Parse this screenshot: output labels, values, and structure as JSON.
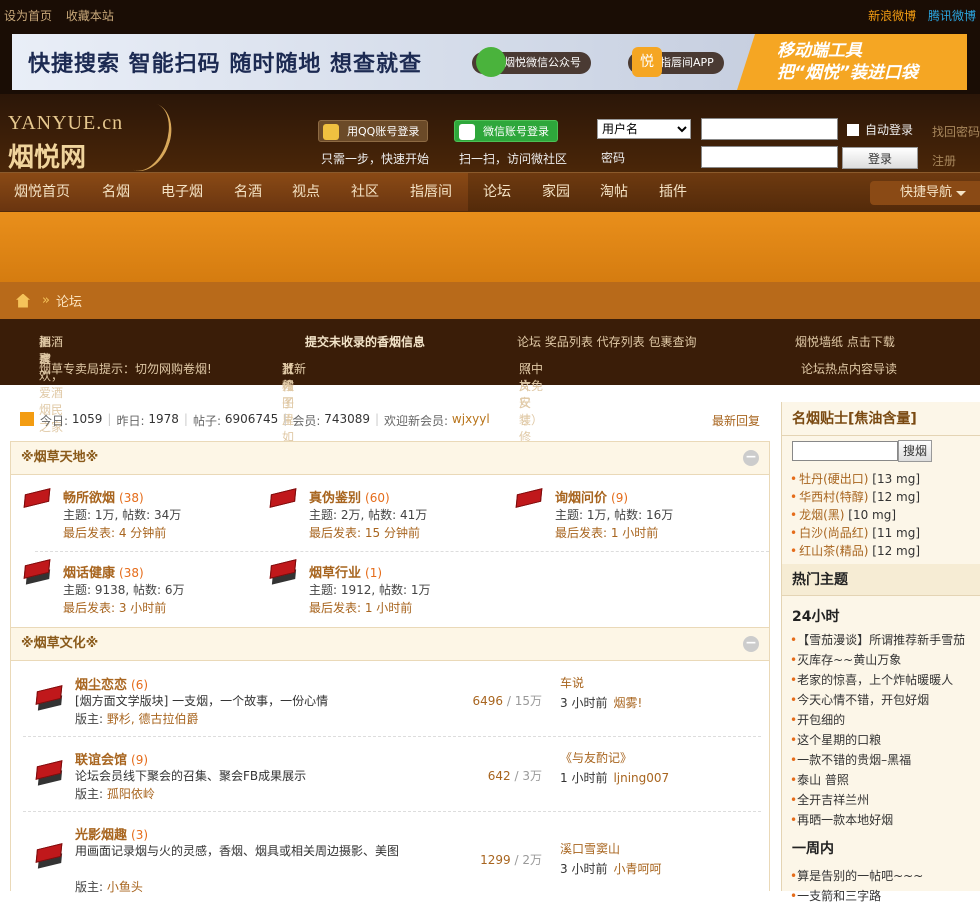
{
  "top": {
    "set_home": "设为首页",
    "bookmark": "收藏本站",
    "sina": "新浪微博",
    "tencent": "腾讯微博"
  },
  "banner": {
    "slogan": "快捷搜索  智能扫码  随时随地  想查就查",
    "wechat": "烟悦微信公众号",
    "app": "指唇间APP",
    "right1": "移动端工具",
    "right2": "把“烟悦”装进口袋",
    "app_icon": "悦"
  },
  "header": {
    "logo_en": "YANYUE.cn",
    "logo_cn": "烟悦网",
    "qq_login": "用QQ账号登录",
    "qq_sub": "只需一步，快速开始",
    "wx_login": "微信账号登录",
    "wx_sub": "扫一扫，访问微社区",
    "username_select": "用户名",
    "password_label": "密码",
    "auto_login": "自动登录",
    "login": "登录",
    "find_pwd": "找回密码",
    "register": "注册"
  },
  "nav": {
    "items": [
      "烟悦首页",
      "名烟",
      "电子烟",
      "名酒",
      "视点",
      "社区",
      "指唇间",
      "论坛",
      "家园",
      "淘帖",
      "插件"
    ],
    "quick": "快捷导航"
  },
  "crumb": {
    "current": "论坛"
  },
  "notice": {
    "n1a": "相聚",
    "n1b": "酒肆",
    "n1c": "把酒言欢，爱酒烟民之家",
    "n2": "提交未收录的香烟信息",
    "n3": "论坛  奖品列表  代存列表  包裹查询",
    "n4": "烟悦墙纸    点击下载",
    "n5": "烟草专卖局提示：切勿网购卷烟!",
    "n6a": "【新人",
    "n6b": "教程",
    "n6c": "】帖子里如何",
    "n6d": "上传图片",
    "n7a": "照片尺寸修改软件",
    "n7b": "（中文免安装）",
    "n8": "论坛热点内容导读"
  },
  "stats": {
    "today_l": "今日:",
    "today": "1059",
    "yest_l": "昨日:",
    "yest": "1978",
    "posts_l": "帖子:",
    "posts": "6906745",
    "members_l": "会员:",
    "members": "743089",
    "welcome": "欢迎新会员:",
    "new_member": "wjxyyl",
    "latest": "最新回复"
  },
  "cat1": {
    "title": "※烟草天地※",
    "collapse": "−"
  },
  "forums1": [
    {
      "name": "畅所欲烟",
      "count": "(38)",
      "stats": "主题: 1万, 帖数: 34万",
      "last": "最后发表: 4 分钟前"
    },
    {
      "name": "真伪鉴别",
      "count": "(60)",
      "stats": "主题: 2万, 帖数: 41万",
      "last": "最后发表: 15 分钟前"
    },
    {
      "name": "询烟问价",
      "count": "(9)",
      "stats": "主题: 1万, 帖数: 16万",
      "last": "最后发表: 1 小时前"
    },
    {
      "name": "烟话健康",
      "count": "(38)",
      "stats": "主题: 9138, 帖数: 6万",
      "last": "最后发表: 3 小时前"
    },
    {
      "name": "烟草行业",
      "count": "(1)",
      "stats": "主题: 1912, 帖数: 1万",
      "last": "最后发表: 1 小时前"
    }
  ],
  "cat2": {
    "title": "※烟草文化※",
    "collapse": "−"
  },
  "forums2": [
    {
      "name": "烟尘恋恋",
      "count": "(6)",
      "desc": "[烟方面文学版块] 一支烟，一个故事，一份心情",
      "mod_l": "版主:",
      "mods": "野杉, 德古拉伯爵",
      "n1": "6496",
      "n2": " / 15万",
      "lt": "车说",
      "lm_time": "3 小时前",
      "lm_user": "烟雾!"
    },
    {
      "name": "联谊会馆",
      "count": "(9)",
      "desc": "论坛会员线下聚会的召集、聚会FB成果展示",
      "mod_l": "版主:",
      "mods": "孤阳依岭",
      "n1": "642",
      "n2": " / 3万",
      "lt": "《与友酌记》",
      "lm_time": "1 小时前",
      "lm_user": "ljning007"
    },
    {
      "name": "光影烟趣",
      "count": "(3)",
      "desc": "用画面记录烟与火的灵感，香烟、烟具或相关周边摄影、美图",
      "mod_l": "版主:",
      "mods": "小鱼头",
      "n1": "1299",
      "n2": " / 2万",
      "lt": "溪口雪窦山",
      "lm_time": "3 小时前",
      "lm_user": "小青呵呵"
    }
  ],
  "sidebar": {
    "title": "名烟贴士[焦油含量]",
    "search": "搜烟",
    "tar": [
      {
        "n": "牡丹(硬出口)",
        "v": "[13 mg]"
      },
      {
        "n": "华西村(特醇)",
        "v": "[12 mg]"
      },
      {
        "n": "龙烟(黑)",
        "v": "[10 mg]"
      },
      {
        "n": "白沙(尚品红)",
        "v": "[11 mg]"
      },
      {
        "n": "红山茶(精品)",
        "v": "[12 mg]"
      }
    ],
    "hot_title": "热门主题",
    "p24": "24小时",
    "hot24": [
      "【雪茄漫谈】所谓推荐新手雪茄",
      "灭库存~~黄山万象",
      "老家的惊喜，上个炸帖暖暖人",
      "今天心情不错，开包好烟",
      "开包细的",
      "这个星期的口粮",
      "一款不错的贵烟–黑福",
      "泰山  普照",
      "全开吉祥兰州",
      "再晒一款本地好烟"
    ],
    "pweek": "一周内",
    "hotw": [
      "算是告别的一帖吧~~~",
      "一支箭和三字路"
    ]
  }
}
